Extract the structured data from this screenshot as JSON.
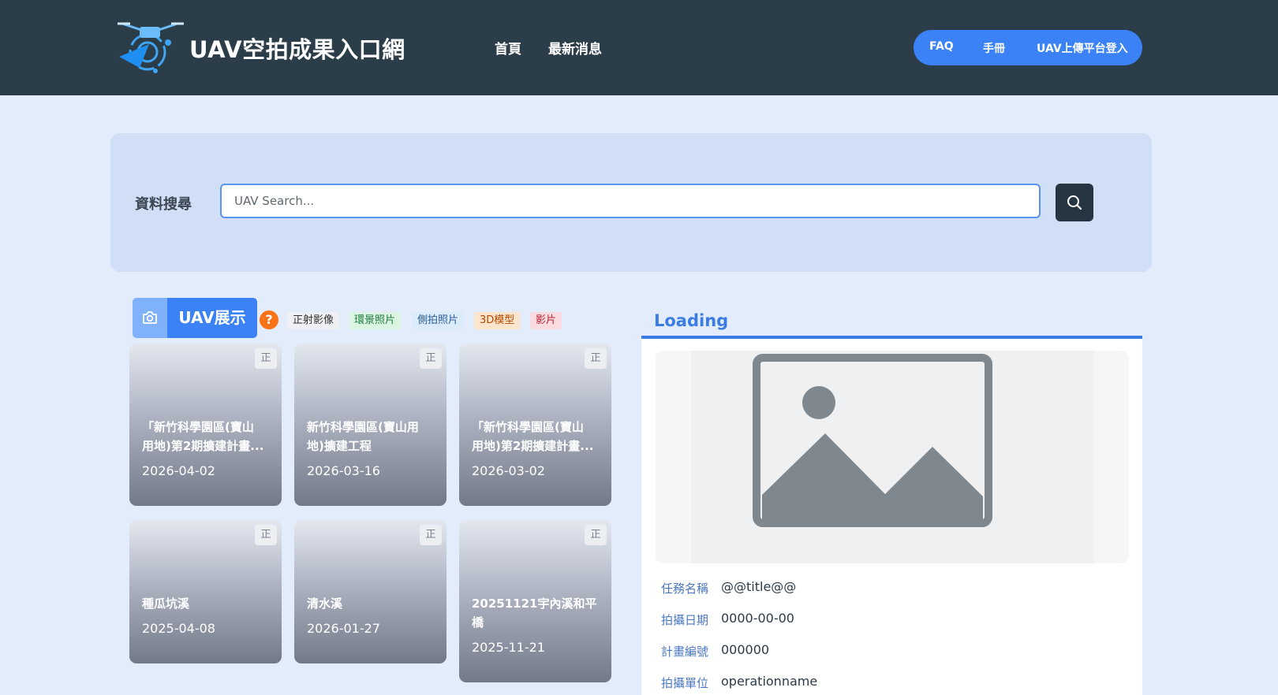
{
  "header": {
    "brand": "UAV空拍成果入口網",
    "logo_icon": "drone-icon",
    "nav": [
      {
        "label": "首頁"
      },
      {
        "label": "最新消息"
      }
    ],
    "pill_links": [
      {
        "label": "FAQ"
      },
      {
        "label": "手冊"
      },
      {
        "label": "UAV上傳平台登入"
      }
    ]
  },
  "search": {
    "label": "資料搜尋",
    "placeholder": "UAV Search...",
    "value": "",
    "button_icon": "search-icon"
  },
  "showcase": {
    "tab_label": "UAV展示",
    "tab_icon": "camera-icon",
    "help_glyph": "?",
    "tags": [
      {
        "label": "正射影像",
        "bg": "#eef0f3",
        "fg": "#333333"
      },
      {
        "label": "環景照片",
        "bg": "#dcf5e3",
        "fg": "#1f7a3c"
      },
      {
        "label": "側拍照片",
        "bg": "#dcebfa",
        "fg": "#2a5d9c"
      },
      {
        "label": "3D模型",
        "bg": "#fde4cc",
        "fg": "#b24a00"
      },
      {
        "label": "影片",
        "bg": "#fadbdf",
        "fg": "#b42331"
      }
    ],
    "cards": [
      {
        "badge": "正",
        "title": "「新竹科學園區(寶山\n用地)第2期擴建計畫...",
        "date": "2026-04-02"
      },
      {
        "badge": "正",
        "title": "新竹科學園區(寶山用\n地)擴建工程",
        "date": "2026-03-16"
      },
      {
        "badge": "正",
        "title": "「新竹科學園區(寶山\n用地)第2期擴建計畫...",
        "date": "2026-03-02"
      },
      {
        "badge": "正",
        "title": "種瓜坑溪",
        "date": "2025-04-08"
      },
      {
        "badge": "正",
        "title": "清水溪",
        "date": "2026-01-27"
      },
      {
        "badge": "正",
        "title": "20251121宇內溪和平\n橋",
        "date": "2025-11-21"
      }
    ]
  },
  "detail": {
    "title": "Loading",
    "image_icon": "image-placeholder-icon",
    "fields": [
      {
        "label": "任務名稱",
        "value": "@@title@@"
      },
      {
        "label": "拍攝日期",
        "value": "0000-00-00"
      },
      {
        "label": "計畫編號",
        "value": "000000"
      },
      {
        "label": "拍攝單位",
        "value": "operationname"
      }
    ]
  },
  "colors": {
    "header_bg": "#2c3d4a",
    "accent": "#3b82f6",
    "page_bg": "#e3ecfb"
  }
}
